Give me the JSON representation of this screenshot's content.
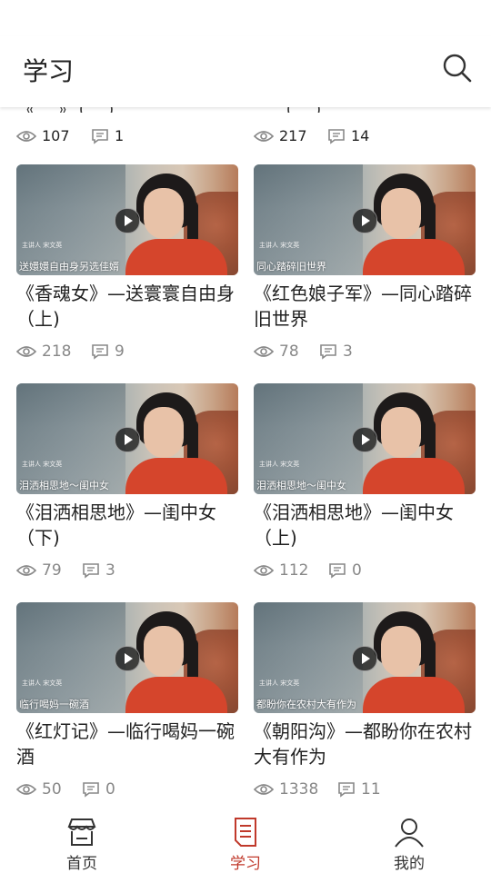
{
  "header": {
    "title": "学习"
  },
  "top_row": [
    {
      "title_fragment": "《…》（…）",
      "views": "107",
      "comments": "1"
    },
    {
      "title_fragment": "…（…）",
      "views": "217",
      "comments": "14"
    }
  ],
  "cards": [
    {
      "caption": "送嬛嬛自由身另选佳婿",
      "title": "《香魂女》—送寰寰自由身（上)",
      "views": "218",
      "comments": "9",
      "lecturer": "主讲人  宋文英"
    },
    {
      "caption": "同心踏碎旧世界",
      "title": "《红色娘子军》—同心踏碎旧世界",
      "views": "78",
      "comments": "3",
      "lecturer": "主讲人  宋文英"
    },
    {
      "caption": "泪洒相思地～闺中女",
      "title": "《泪洒相思地》—闺中女（下)",
      "views": "79",
      "comments": "3",
      "lecturer": "主讲人  宋文英"
    },
    {
      "caption": "泪洒相思地～闺中女",
      "title": "《泪洒相思地》—闺中女（上)",
      "views": "112",
      "comments": "0",
      "lecturer": "主讲人  宋文英"
    },
    {
      "caption": "临行喝妈一碗酒",
      "title": "《红灯记》—临行喝妈一碗酒",
      "views": "50",
      "comments": "0",
      "lecturer": "主讲人  宋文英"
    },
    {
      "caption": "都盼你在农村大有作为",
      "title": "《朝阳沟》—都盼你在农村大有作为",
      "views": "1338",
      "comments": "11",
      "lecturer": "主讲人  宋文英"
    }
  ],
  "tabs": [
    {
      "label": "首页",
      "icon": "shop-icon",
      "active": false
    },
    {
      "label": "学习",
      "icon": "document-icon",
      "active": true
    },
    {
      "label": "我的",
      "icon": "person-icon",
      "active": false
    }
  ],
  "colors": {
    "accent": "#c0392b",
    "muted": "#888888"
  }
}
